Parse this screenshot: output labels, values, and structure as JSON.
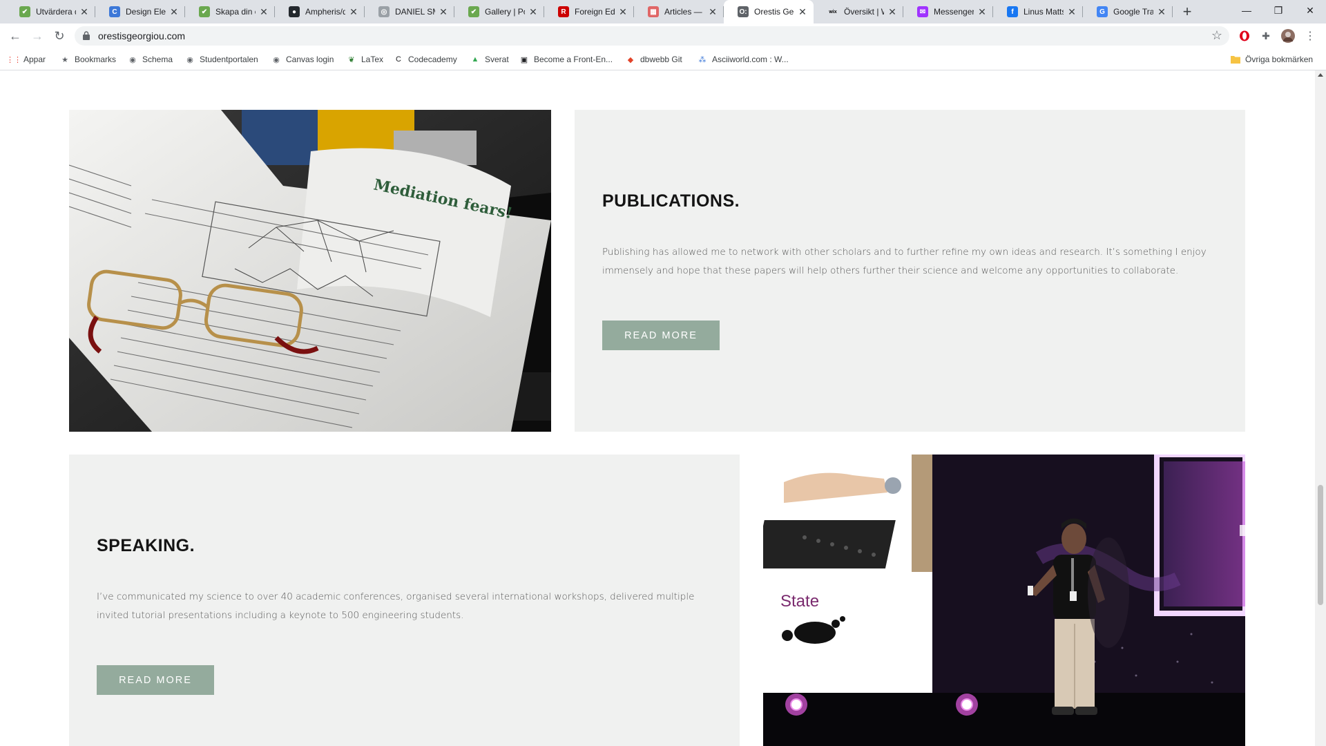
{
  "browser": {
    "tabs": [
      {
        "title": "Utvärdera d",
        "favicon_color": "#6aa84f",
        "glyph": "✔"
      },
      {
        "title": "Design Elem",
        "favicon_color": "#3c78d8",
        "glyph": "C"
      },
      {
        "title": "Skapa din e",
        "favicon_color": "#6aa84f",
        "glyph": "✔"
      },
      {
        "title": "Ampheris/d",
        "favicon_color": "#24292e",
        "glyph": "●"
      },
      {
        "title": "DANIEL SMI",
        "favicon_color": "#9aa0a6",
        "glyph": "◎"
      },
      {
        "title": "Gallery | Por",
        "favicon_color": "#6aa84f",
        "glyph": "✔"
      },
      {
        "title": "Foreign Edit",
        "favicon_color": "#cc0000",
        "glyph": "R"
      },
      {
        "title": "Articles — X",
        "favicon_color": "#e06666",
        "glyph": "▦"
      },
      {
        "title": "Orestis Geo",
        "favicon_color": "#5f6368",
        "glyph": "O:",
        "active": true
      },
      {
        "title": "Översikt | W",
        "favicon_color": "#000000",
        "glyph": "wix"
      },
      {
        "title": "Messenger",
        "favicon_color": "#a033ff",
        "glyph": "✉"
      },
      {
        "title": "Linus Matts",
        "favicon_color": "#1877f2",
        "glyph": "f"
      },
      {
        "title": "Google Tran",
        "favicon_color": "#4285f4",
        "glyph": "G"
      }
    ],
    "url": "orestisgeorgiou.com",
    "bookmarks": [
      {
        "label": "Appar",
        "icon": "apps-grid-icon"
      },
      {
        "label": "Bookmarks",
        "icon": "star-icon"
      },
      {
        "label": "Schema",
        "icon": "globe-icon"
      },
      {
        "label": "Studentportalen",
        "icon": "globe-icon"
      },
      {
        "label": "Canvas login",
        "icon": "globe-icon"
      },
      {
        "label": "LaTex",
        "icon": "leaf-icon"
      },
      {
        "label": "Codecademy",
        "icon": "codecademy-icon"
      },
      {
        "label": "Sverat",
        "icon": "drive-icon"
      },
      {
        "label": "Become a Front-En...",
        "icon": "terminal-icon"
      },
      {
        "label": "dbwebb Git",
        "icon": "gitlab-icon"
      },
      {
        "label": "Asciiworld.com : W...",
        "icon": "ascii-icon"
      }
    ],
    "other_bookmarks": "Övriga bokmärken"
  },
  "page": {
    "publications": {
      "heading": "PUBLICATIONS.",
      "body": "Publishing has allowed me to network with other scholars and to further refine my own ideas and research. It’s something I enjoy immensely and hope that these papers will help others further their science and welcome any opportunities to collaborate.",
      "button": "READ MORE"
    },
    "speaking": {
      "heading": "SPEAKING.",
      "body": "I’ve communicated my science to over 40 academic conferences, organised several international workshops, delivered multiple invited tutorial presentations including a keynote to 500 engineering students.",
      "button": "READ MORE"
    },
    "slide_text": "State",
    "colors": {
      "panel_bg": "#f0f1f0",
      "button_bg": "#94ab9d",
      "heading": "#141414"
    }
  }
}
